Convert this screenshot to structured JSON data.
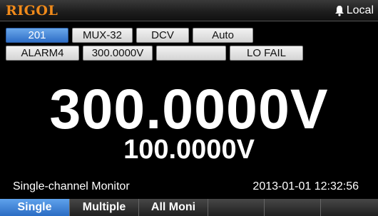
{
  "header": {
    "brand": "RIGOL",
    "status": "Local",
    "status_icon": "bell-icon"
  },
  "params": {
    "row1": [
      "201",
      "MUX-32",
      "DCV",
      "Auto"
    ],
    "row2": [
      "ALARM4",
      "300.0000V",
      "",
      "LO FAIL"
    ],
    "active": "201"
  },
  "readings": {
    "primary": "300.0000V",
    "secondary": "100.0000V"
  },
  "footer": {
    "mode": "Single-channel Monitor",
    "datetime": "2013-01-01 12:32:56"
  },
  "softkeys": {
    "items": [
      "Single",
      "Multiple",
      "All Moni",
      "",
      "",
      ""
    ],
    "active": "Single"
  },
  "colors": {
    "brand": "#f08a1a",
    "accent": "#2f6fc7",
    "background": "#000000"
  }
}
